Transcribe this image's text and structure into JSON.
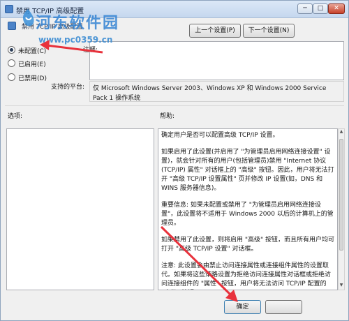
{
  "window": {
    "title": "禁用 TCP/IP 高级配置",
    "subtitle": "禁用 TCP/IP 高级配置",
    "min_label": "─",
    "max_label": "□",
    "close_label": "✕"
  },
  "nav": {
    "prev_label": "上一个设置(P)",
    "next_label": "下一个设置(N)"
  },
  "state": {
    "options": [
      {
        "label": "未配置(C)",
        "selected": true
      },
      {
        "label": "已启用(E)",
        "selected": false
      },
      {
        "label": "已禁用(D)",
        "selected": false
      }
    ]
  },
  "comment": {
    "label": "注释:",
    "value": ""
  },
  "platform": {
    "label": "支持的平台:",
    "value": "仅 Microsoft Windows Server 2003、Windows XP 和 Windows 2000 Service Pack 1 操作系统"
  },
  "sections": {
    "options_label": "选项:",
    "help_label": "帮助:"
  },
  "help": {
    "paragraphs": [
      "确定用户是否可以配置高级 TCP/IP 设置。",
      "如果启用了此设置(并启用了 \"为管理员启用网络连接设置\" 设置)，就会针对所有的用户(包括管理员)禁用 \"Internet 协议 (TCP/IP) 属性\" 对话框上的 \"高级\" 按钮。因此，用户将无法打开 \"高级 TCP/IP 设置属性\" 页并修改 IP 设置(如，DNS 和 WINS 服务器信息)。",
      "重要信息: 如果未配置或禁用了 \"为管理员启用网络连接设置\"，此设置将不适用于 Windows 2000 以后的计算机上的管理员。",
      "如果禁用了此设置，则将启用 \"高级\" 按钮，而且所有用户均可打开 \"高级 TCP/IP 设置\" 对话框。",
      "注意: 此设置会由禁止访问连接属性或连接组件属性的设置取代。如果将这些策略设置为拒绝访问连接属性对话框或拒绝访问连接组件的 \"属性\" 按钮，用户将无法访问 TCP/IP 配置的 \"高级\" 按钮。"
    ]
  },
  "footer": {
    "ok_label": "确定",
    "cancel_label": ""
  },
  "watermark": {
    "title": "河东软件园",
    "url": "www.pc0359.cn"
  },
  "colors": {
    "annotation_arrow": "#e8323c",
    "watermark": "#3282d2"
  },
  "icons": {
    "window": "policy-icon",
    "scroll_up": "chevron-up-icon",
    "scroll_down": "chevron-down-icon"
  }
}
